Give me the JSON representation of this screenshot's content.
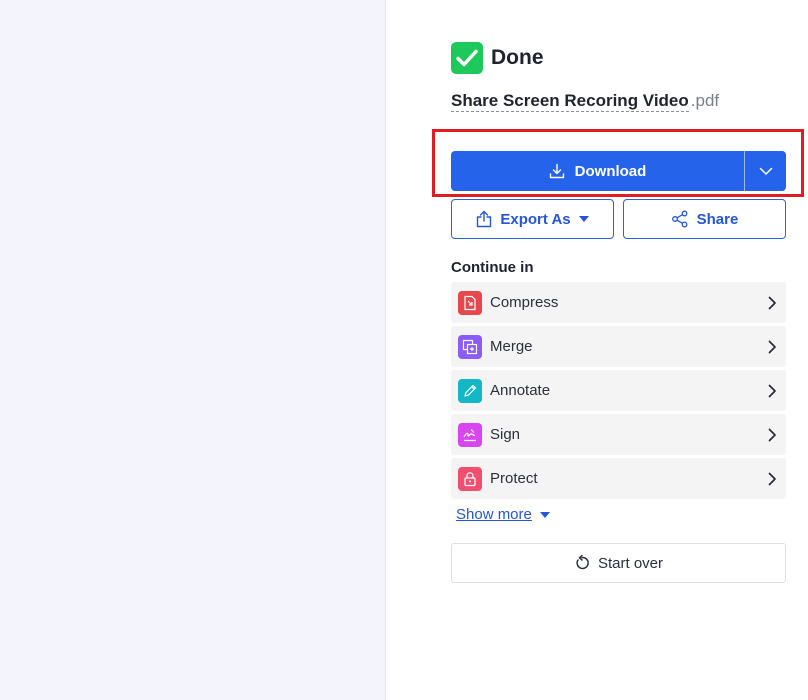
{
  "status": {
    "title": "Done"
  },
  "file": {
    "name": "Share Screen Recoring Video",
    "extension": ".pdf"
  },
  "actions": {
    "download_label": "Download",
    "export_label": "Export As",
    "share_label": "Share"
  },
  "continue": {
    "heading": "Continue in",
    "tools": [
      {
        "label": "Compress",
        "icon": "compress-icon",
        "color": "#e5484d"
      },
      {
        "label": "Merge",
        "icon": "merge-icon",
        "color": "#8b5cf6"
      },
      {
        "label": "Annotate",
        "icon": "annotate-icon",
        "color": "#14b8c4"
      },
      {
        "label": "Sign",
        "icon": "sign-icon",
        "color": "#d946ef"
      },
      {
        "label": "Protect",
        "icon": "lock-icon",
        "color": "#f0506e"
      }
    ]
  },
  "show_more_label": "Show more",
  "start_over_label": "Start over",
  "colors": {
    "primary": "#2563eb",
    "success": "#1ec95b",
    "highlight": "#e01d22"
  }
}
